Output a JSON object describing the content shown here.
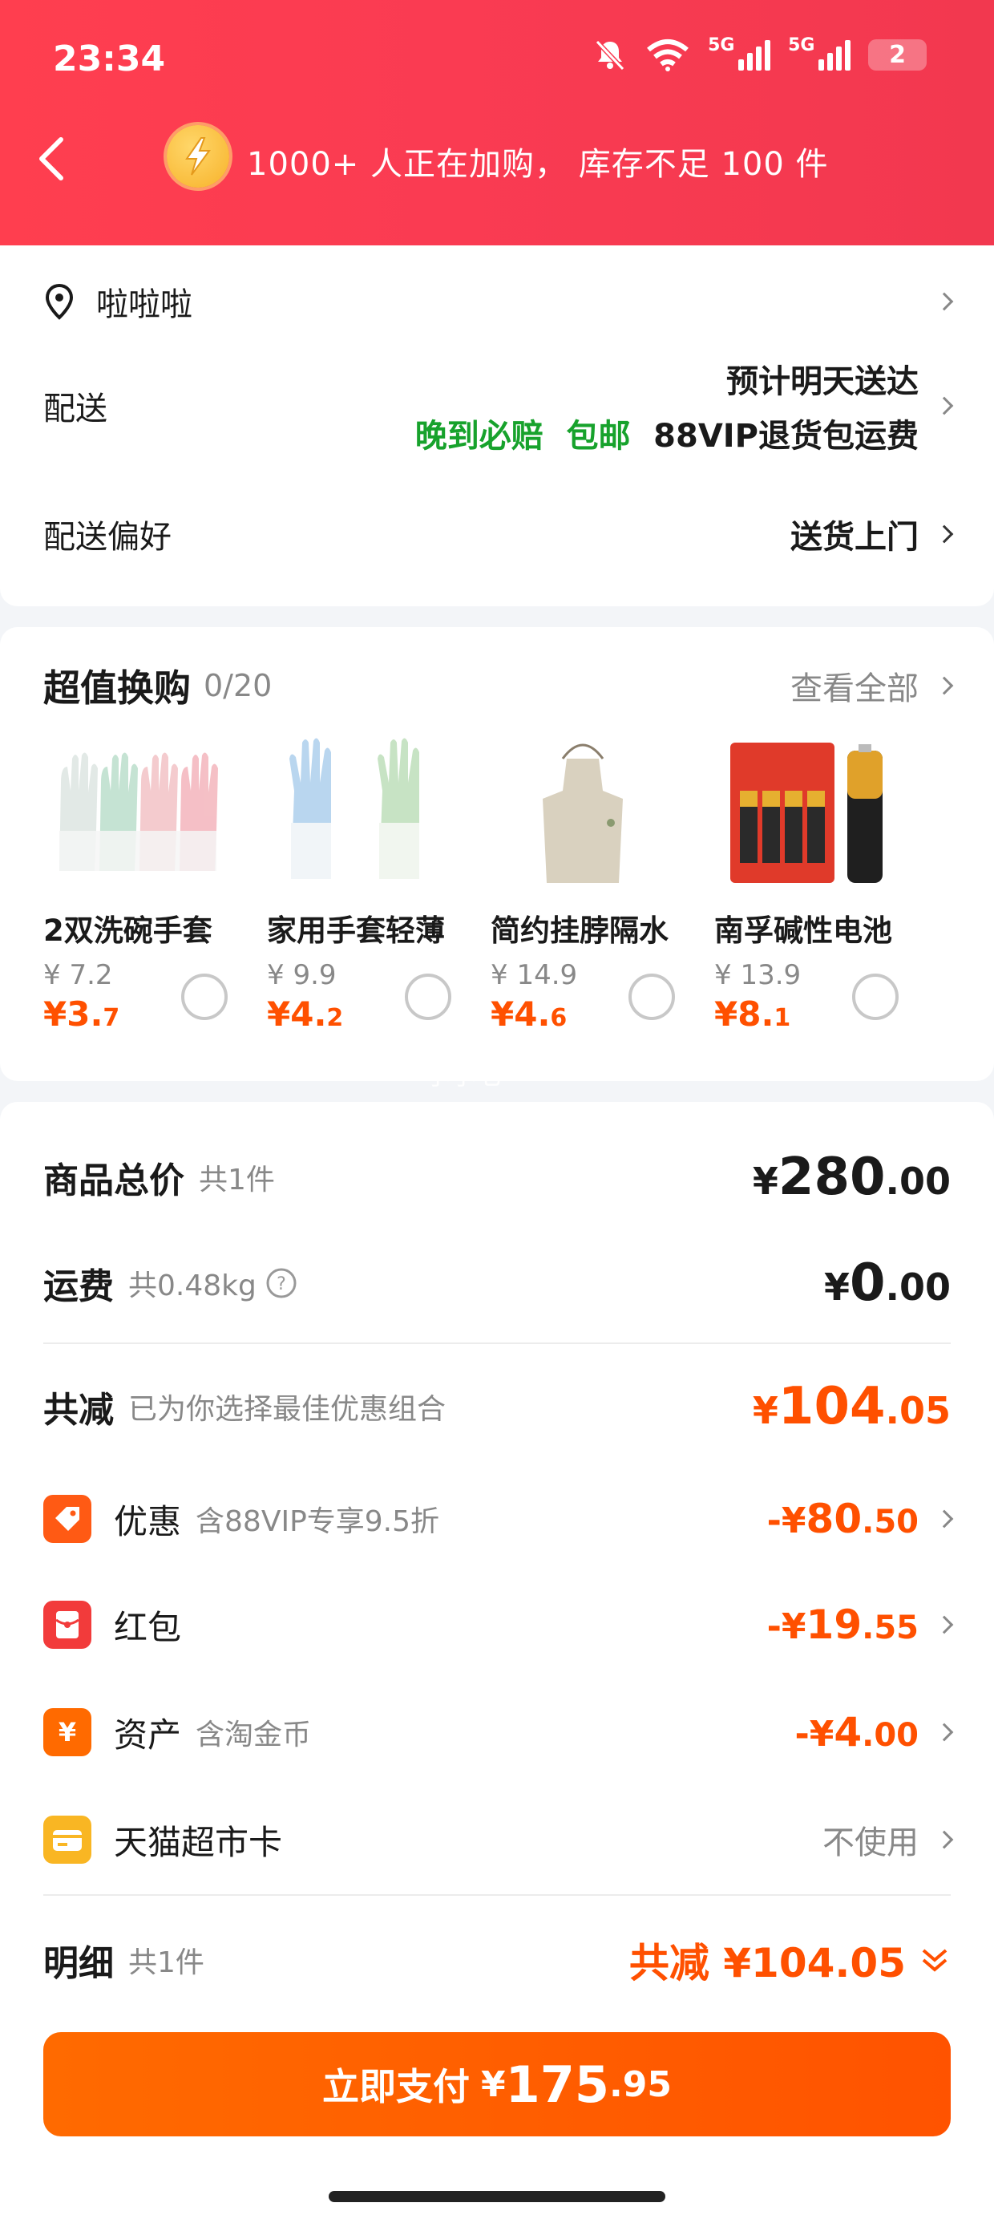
{
  "status_bar": {
    "time": "23:34",
    "network_label_1": "5G",
    "network_label_2": "5G",
    "battery": "2"
  },
  "header": {
    "message": "1000+ 人正在加购， 库存不足 100 件",
    "back_icon": "back-arrow-icon",
    "flash_icon": "flash-icon"
  },
  "address": {
    "name": "啦啦啦"
  },
  "delivery": {
    "label": "配送",
    "estimate": "预计明天送达",
    "tag_late": "晚到必赔",
    "tag_free": "包邮",
    "tag_vip": "88VIP退货包运费"
  },
  "delivery_pref": {
    "label": "配送偏好",
    "value": "送货上门"
  },
  "swap": {
    "title": "超值换购",
    "count": "0/20",
    "view_all": "查看全部",
    "items": [
      {
        "name": "2双洗碗手套",
        "old_price": "¥ 7.2",
        "new_int": "¥3.",
        "new_dec": "7"
      },
      {
        "name": "家用手套轻薄",
        "old_price": "¥ 9.9",
        "new_int": "¥4.",
        "new_dec": "2"
      },
      {
        "name": "简约挂脖隔水",
        "old_price": "¥ 14.9",
        "new_int": "¥4.",
        "new_dec": "6"
      },
      {
        "name": "南孚碱性电池",
        "old_price": "¥ 13.9",
        "new_int": "¥8.",
        "new_dec": "1"
      }
    ]
  },
  "watermark": "小小七",
  "summary": {
    "goods_label": "商品总价",
    "goods_count": "共1件",
    "goods_cur": "¥",
    "goods_int": "280",
    "goods_dec": ".00",
    "shipping_label": "运费",
    "shipping_weight": "共0.48kg",
    "shipping_cur": "¥",
    "shipping_int": "0",
    "shipping_dec": ".00",
    "total_off_label": "共减",
    "total_off_note": "已为你选择最佳优惠组合",
    "total_off_cur": "¥",
    "total_off_int": "104",
    "total_off_dec": ".05"
  },
  "discounts": [
    {
      "label": "优惠",
      "note": "含88VIP专享9.5折",
      "prefix": "-¥",
      "int": "80",
      "dec": ".50",
      "icon": "tag-icon"
    },
    {
      "label": "红包",
      "note": "",
      "prefix": "-¥",
      "int": "19",
      "dec": ".55",
      "icon": "red-packet-icon"
    },
    {
      "label": "资产",
      "note": "含淘金币",
      "prefix": "-¥",
      "int": "4",
      "dec": ".00",
      "icon": "yuan-coin-icon"
    },
    {
      "label": "天猫超市卡",
      "note": "",
      "value": "不使用",
      "icon": "card-icon"
    }
  ],
  "detail": {
    "label": "明细",
    "count": "共1件",
    "total_off": "共减 ¥104.05"
  },
  "pay_button": {
    "label": "立即支付",
    "cur": "¥",
    "int": "175",
    "dec": ".95"
  },
  "colors": {
    "header_red": "#fa3b52",
    "accent_orange": "#ff5000",
    "green": "#17a22c"
  }
}
